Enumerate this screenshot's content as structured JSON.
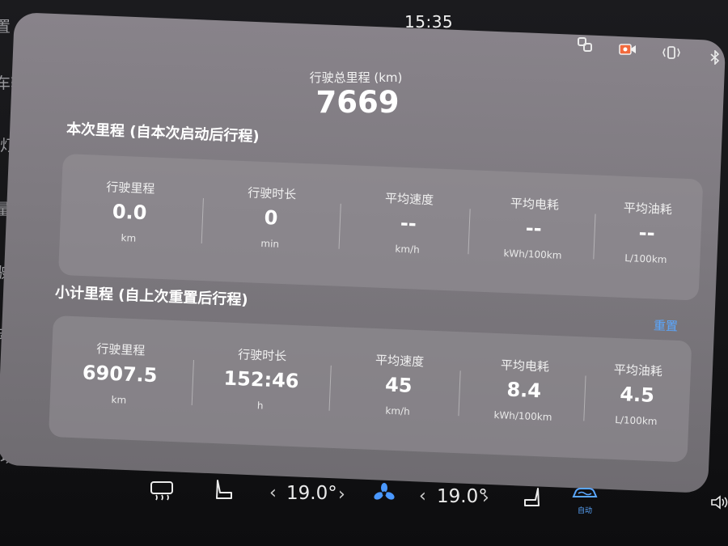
{
  "status_bar": {
    "time": "15:35",
    "icons": [
      "link-icon",
      "camera-icon",
      "vibrate-icon",
      "bluetooth-icon"
    ]
  },
  "left_menu": {
    "items": [
      "置",
      "车辆抖",
      "灯光",
      "量",
      "驶",
      "动驾",
      "辆状",
      "场景"
    ]
  },
  "total": {
    "label": "行驶总里程 (km)",
    "value": "7669"
  },
  "trip": {
    "title": "本次里程 (自本次启动后行程)",
    "stats": [
      {
        "label": "行驶里程",
        "value": "0.0",
        "unit": "km"
      },
      {
        "label": "行驶时长",
        "value": "0",
        "unit": "min"
      },
      {
        "label": "平均速度",
        "value": "--",
        "unit": "km/h"
      },
      {
        "label": "平均电耗",
        "value": "--",
        "unit": "kWh/100km"
      },
      {
        "label": "平均油耗",
        "value": "--",
        "unit": "L/100km"
      }
    ]
  },
  "subtotal": {
    "title": "小计里程 (自上次重置后行程)",
    "reset_label": "重置",
    "stats": [
      {
        "label": "行驶里程",
        "value": "6907.5",
        "unit": "km"
      },
      {
        "label": "行驶时长",
        "value": "152:46",
        "unit": "h"
      },
      {
        "label": "平均速度",
        "value": "45",
        "unit": "km/h"
      },
      {
        "label": "平均电耗",
        "value": "8.4",
        "unit": "kWh/100km"
      },
      {
        "label": "平均油耗",
        "value": "4.5",
        "unit": "L/100km"
      }
    ]
  },
  "climate": {
    "left_temp": "19.0°",
    "right_temp": "19.0°",
    "auto_label": "自动",
    "left_decrease": "‹",
    "left_increase": "›",
    "right_decrease": "‹",
    "right_increase": "›",
    "accent_color": "#5aa7ff"
  },
  "colors": {
    "accent": "#5aa7ff",
    "panel": "#827e84"
  }
}
